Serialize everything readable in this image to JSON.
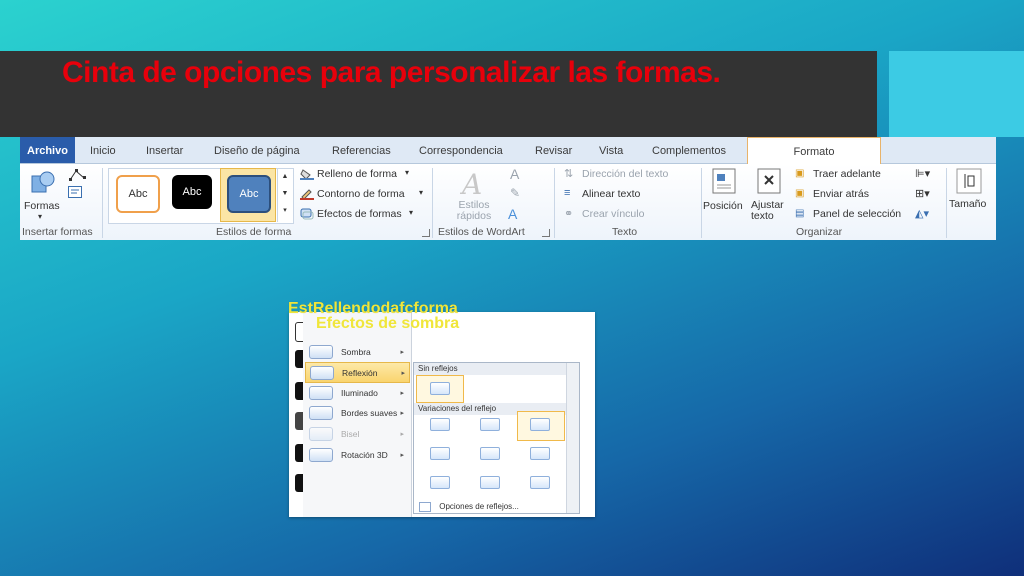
{
  "slide": {
    "title": "Cinta de opciones para personalizar las formas.",
    "overlay_line1": "EstRellendodafcforma",
    "overlay_line2": "Efectos de sombra",
    "colors": {
      "title": "#e8000b",
      "overlay": "#f0e63a",
      "title_bar": "#333333",
      "accent_box": "#3ccbe4"
    }
  },
  "ribbon": {
    "tabs": [
      "Archivo",
      "Inicio",
      "Insertar",
      "Diseño de página",
      "Referencias",
      "Correspondencia",
      "Revisar",
      "Vista",
      "Complementos",
      "Formato"
    ],
    "insertar_formas": {
      "formas_label": "Formas",
      "group_label": "Insertar formas"
    },
    "estilos_forma": {
      "thumb_labels": [
        "Abc",
        "Abc",
        "Abc"
      ],
      "relleno": "Relleno de forma",
      "contorno": "Contorno de forma",
      "efectos": "Efectos de formas",
      "group_label": "Estilos de forma"
    },
    "wordart": {
      "estilos_rapidos": "Estilos rápidos",
      "group_label": "Estilos de WordArt"
    },
    "texto": {
      "direccion": "Dirección del texto",
      "alinear": "Alinear texto",
      "crear_vinculo": "Crear vínculo",
      "group_label": "Texto"
    },
    "organizar": {
      "posicion": "Posición",
      "ajustar": "Ajustar texto",
      "traer": "Traer adelante",
      "enviar": "Enviar atrás",
      "panel": "Panel de selección",
      "group_label": "Organizar"
    },
    "tamano": {
      "label": "Tamaño"
    }
  },
  "dropdown": {
    "items": [
      "Sombra",
      "Reflexión",
      "Iluminado",
      "Bordes suaves",
      "Bisel",
      "Rotación 3D"
    ],
    "selected_item": "Reflexión",
    "submenu": {
      "header_none": "Sin reflejos",
      "header_variations": "Variaciones del reflejo",
      "options_link": "Opciones de reflejos..."
    }
  }
}
